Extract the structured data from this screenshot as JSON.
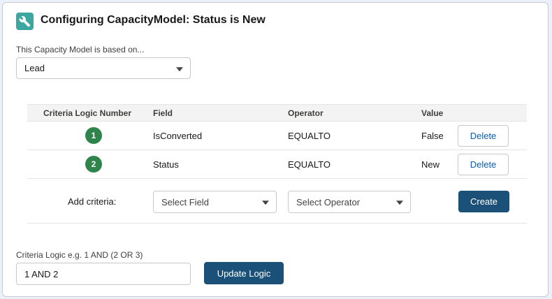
{
  "header": {
    "title": "Configuring CapacityModel: Status is New",
    "icon": "wrench-icon",
    "icon_color": "#3ba7a0"
  },
  "base_object": {
    "label": "This Capacity Model is based on...",
    "selected": "Lead"
  },
  "criteria_table": {
    "columns": [
      "Criteria Logic Number",
      "Field",
      "Operator",
      "Value"
    ],
    "rows": [
      {
        "number": "1",
        "field": "IsConverted",
        "operator": "EQUALTO",
        "value": "False",
        "action": "Delete"
      },
      {
        "number": "2",
        "field": "Status",
        "operator": "EQUALTO",
        "value": "New",
        "action": "Delete"
      }
    ]
  },
  "add_criteria": {
    "label": "Add criteria:",
    "field_placeholder": "Select Field",
    "operator_placeholder": "Select Operator",
    "create_label": "Create"
  },
  "logic": {
    "label": "Criteria Logic e.g. 1 AND (2 OR 3)",
    "value": "1 AND 2",
    "update_label": "Update Logic"
  },
  "colors": {
    "brand_button": "#1b5079",
    "badge_green": "#2e844a",
    "link_blue": "#0b5cab"
  }
}
